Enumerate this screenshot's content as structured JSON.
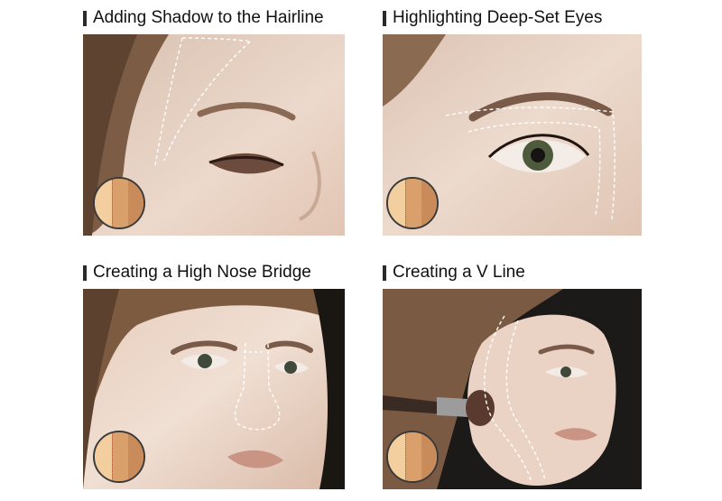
{
  "panels": [
    {
      "title": "Adding Shadow to the Hairline"
    },
    {
      "title": "Highlighting Deep-Set Eyes"
    },
    {
      "title": "Creating a High Nose Bridge"
    },
    {
      "title": "Creating a V Line"
    }
  ],
  "colors": {
    "skin_light": "#e9d2c4",
    "skin_mid": "#d8b6a3",
    "hair": "#7a5a40",
    "guide_line": "#ffffff",
    "swatch_light": "#f3cf9f",
    "swatch_mid": "#d9a06b",
    "swatch_dark": "#c98b59"
  }
}
